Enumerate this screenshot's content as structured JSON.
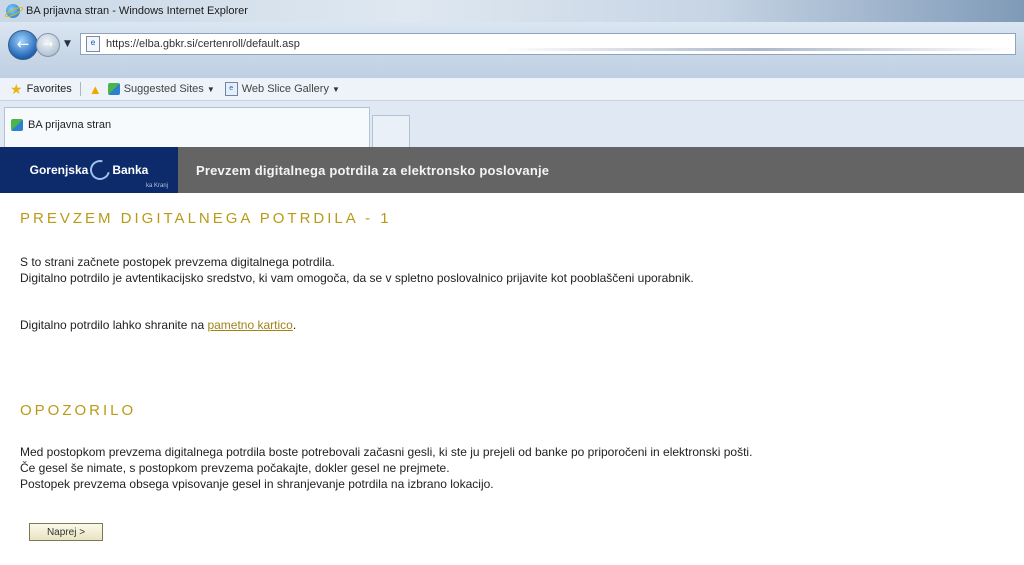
{
  "window": {
    "title": "BA prijavna stran - Windows Internet Explorer"
  },
  "nav": {
    "url": "https://elba.gbkr.si/certenroll/default.asp"
  },
  "favorites_bar": {
    "favorites_label": "Favorites",
    "items": [
      "Suggested Sites",
      "Web Slice Gallery"
    ]
  },
  "tab": {
    "title": "BA prijavna stran"
  },
  "header": {
    "logo_text_1": "Gorenjska",
    "logo_text_2": "Banka",
    "logo_sub": "ka Kranj",
    "title": "Prevzem digitalnega potrdila za elektronsko poslovanje"
  },
  "section1": {
    "title": "PREVZEM DIGITALNEGA POTRDILA - 1",
    "line1": "S to strani začnete postopek prevzema digitalnega potrdila.",
    "line2": "Digitalno potrdilo je avtentikacijsko sredstvo, ki vam omogoča, da se v spletno poslovalnico prijavite kot pooblaščeni uporabnik.",
    "line3_prefix": "Digitalno potrdilo lahko shranite na ",
    "line3_link": "pametno kartico",
    "line3_suffix": "."
  },
  "section2": {
    "title": "OPOZORILO",
    "line1": "Med postopkom prevzema digitalnega potrdila boste potrebovali začasni gesli, ki ste ju prejeli od banke po priporočeni in elektronski pošti.",
    "line2": "Če gesel še nimate, s postopkom prevzema počakajte, dokler gesel ne prejmete.",
    "line3": "Postopek prevzema obsega vpisovanje gesel in shranjevanje potrdila na izbrano lokacijo."
  },
  "next_button": {
    "label": "Naprej >"
  }
}
